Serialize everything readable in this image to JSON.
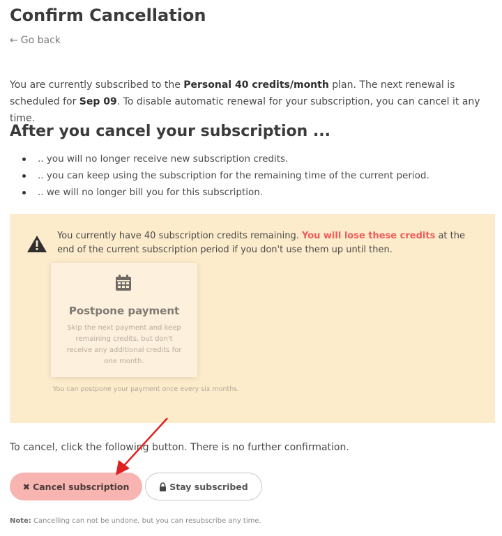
{
  "page": {
    "title": "Confirm Cancellation",
    "back_label": "Go back",
    "intro": {
      "part1": "You are currently subscribed to the ",
      "plan": "Personal 40 credits/month",
      "part2": " plan. The next renewal is scheduled for ",
      "date": "Sep 09",
      "part3": ". To disable automatic renewal for your subscription, you can cancel it any time."
    },
    "after_heading": "After you cancel your subscription ...",
    "bullets": [
      ".. you will no longer receive new subscription credits.",
      ".. you can keep using the subscription for the remaining time of the current period.",
      ".. we will no longer bill you for this subscription."
    ]
  },
  "warning": {
    "part1": "You currently have 40 subscription credits remaining. ",
    "highlight": "You will lose these credits",
    "part2": " at the end of the current subscription period if you don't use them up until then.",
    "icon": "warning-triangle-icon"
  },
  "postpone_card": {
    "icon": "calendar-icon",
    "title": "Postpone payment",
    "description": "Skip the next payment and keep remaining credits, but don't receive any additional credits for one month.",
    "note": "You can postpone your payment once every six months."
  },
  "cancel_section": {
    "info": "To cancel, click the following button. There is no further confirmation.",
    "cancel_button": "Cancel subscription",
    "stay_button": "Stay subscribed",
    "note_label": "Note:",
    "note_text": " Cancelling can not be undone, but you can resubscribe any time."
  },
  "colors": {
    "warning_bg": "#fdeccb",
    "highlight_red": "#ef5b5b",
    "cancel_button_bg": "#f8b4b0",
    "annotation_arrow": "#e02020"
  }
}
